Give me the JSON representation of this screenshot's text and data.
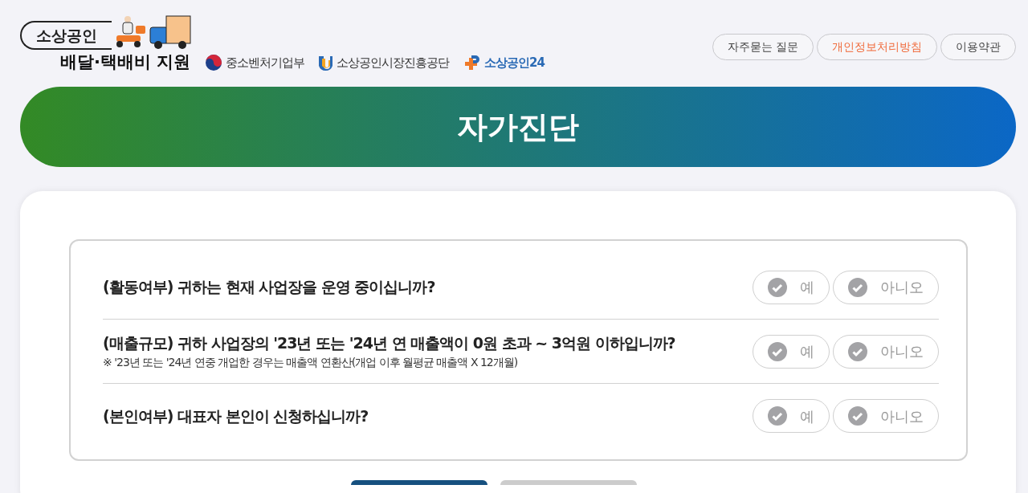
{
  "logo": {
    "title": "소상공인",
    "subtitle": "배달·택배비 지원"
  },
  "partners": [
    {
      "kind": "ministry",
      "name": "중소벤처기업부"
    },
    {
      "kind": "agency",
      "name": "소상공인시장진흥공단"
    },
    {
      "kind": "portal",
      "name": "소상공인24"
    }
  ],
  "top_links": [
    {
      "label": "자주묻는 질문",
      "highlighted": false
    },
    {
      "label": "개인정보처리방침",
      "highlighted": true
    },
    {
      "label": "이용약관",
      "highlighted": false
    }
  ],
  "banner": {
    "title": "자가진단"
  },
  "questions": [
    {
      "text": "(활동여부) 귀하는 현재 사업장을 운영 중이십니까?",
      "options": [
        {
          "label": "예",
          "selected": false
        },
        {
          "label": "아니오",
          "selected": false
        }
      ]
    },
    {
      "text": "(매출규모) 귀하 사업장의 '23년 또는 '24년 연 매출액이 0원 초과 ~ 3억원 이하입니까?",
      "note": "※ '23년 또는 '24년 연중 개업한 경우는 매출액 연환산(개업 이후 월평균 매출액 X 12개월)",
      "options": [
        {
          "label": "예",
          "selected": false
        },
        {
          "label": "아니오",
          "selected": false
        }
      ]
    },
    {
      "text": "(본인여부) 대표자 본인이 신청하십니까?",
      "options": [
        {
          "label": "예",
          "selected": false
        },
        {
          "label": "아니오",
          "selected": false
        }
      ]
    }
  ]
}
